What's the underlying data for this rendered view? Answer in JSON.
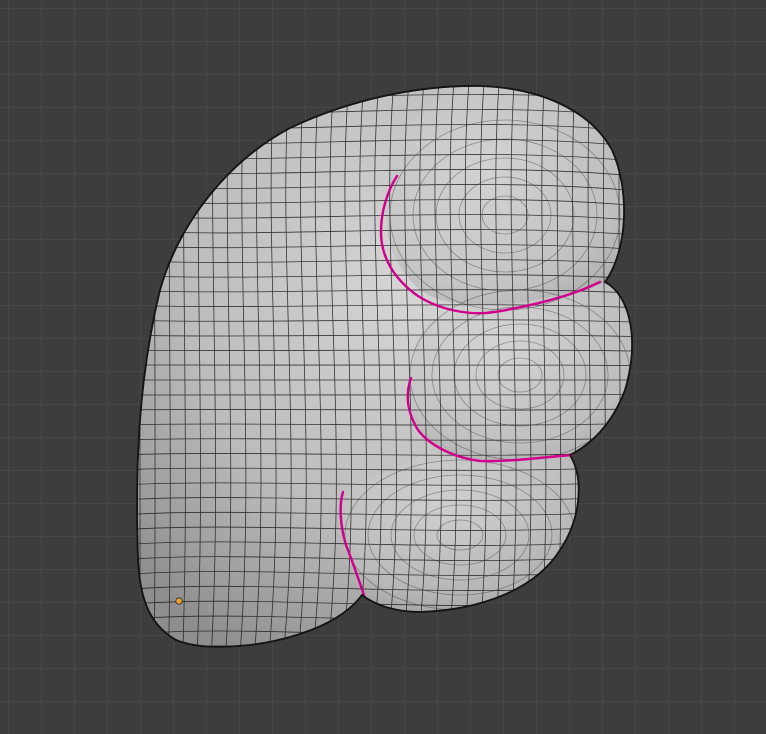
{
  "viewport": {
    "background_color": "#3d3d3d",
    "grid_color": "#474747"
  },
  "mesh": {
    "name": "",
    "surface_color": "#bdbdbd",
    "wire_color": "#111111",
    "seam_color": "#d1008c",
    "origin_color": "#f0a030"
  }
}
